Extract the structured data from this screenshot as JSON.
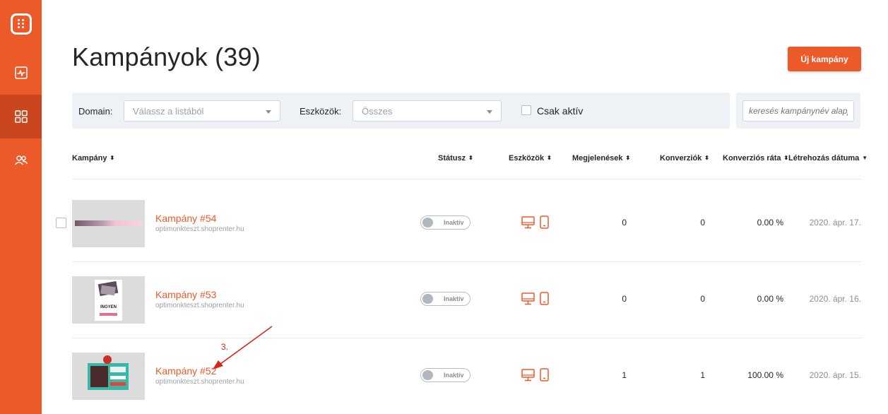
{
  "sidebar": {
    "items": [
      {
        "icon": "logo-icon"
      },
      {
        "icon": "analytics-icon"
      },
      {
        "icon": "dashboard-icon",
        "active": true
      },
      {
        "icon": "users-icon"
      }
    ],
    "accent": "#ed5a29"
  },
  "header": {
    "title": "Kampányok (39)",
    "new_button": "Új kampány"
  },
  "filters": {
    "domain_label": "Domain:",
    "domain_placeholder": "Válassz a listából",
    "devices_label": "Eszközök:",
    "devices_value": "Összes",
    "active_only_label": "Csak aktív",
    "search_placeholder": "keresés kampánynév alapján"
  },
  "table": {
    "columns": [
      "Kampány",
      "Státusz",
      "Eszközök",
      "Megjelenések",
      "Konverziók",
      "Konverziós ráta",
      "Létrehozás dátuma"
    ],
    "rows": [
      {
        "name": "Kampány #54",
        "domain": "optimonkteszt.shoprenter.hu",
        "status": "Inaktív",
        "impressions": "0",
        "conversions": "0",
        "rate": "0.00 %",
        "created": "2020. ápr. 17."
      },
      {
        "name": "Kampány #53",
        "domain": "optimonkteszt.shoprenter.hu",
        "status": "Inaktív",
        "impressions": "0",
        "conversions": "0",
        "rate": "0.00 %",
        "created": "2020. ápr. 16.",
        "thumb_text": "INGYEN"
      },
      {
        "name": "Kampány #52",
        "domain": "optimonkteszt.shoprenter.hu",
        "status": "Inaktív",
        "impressions": "1",
        "conversions": "1",
        "rate": "100.00 %",
        "created": "2020. ápr. 15."
      }
    ]
  },
  "annotation": {
    "label": "3.",
    "color": "#d9221a"
  }
}
